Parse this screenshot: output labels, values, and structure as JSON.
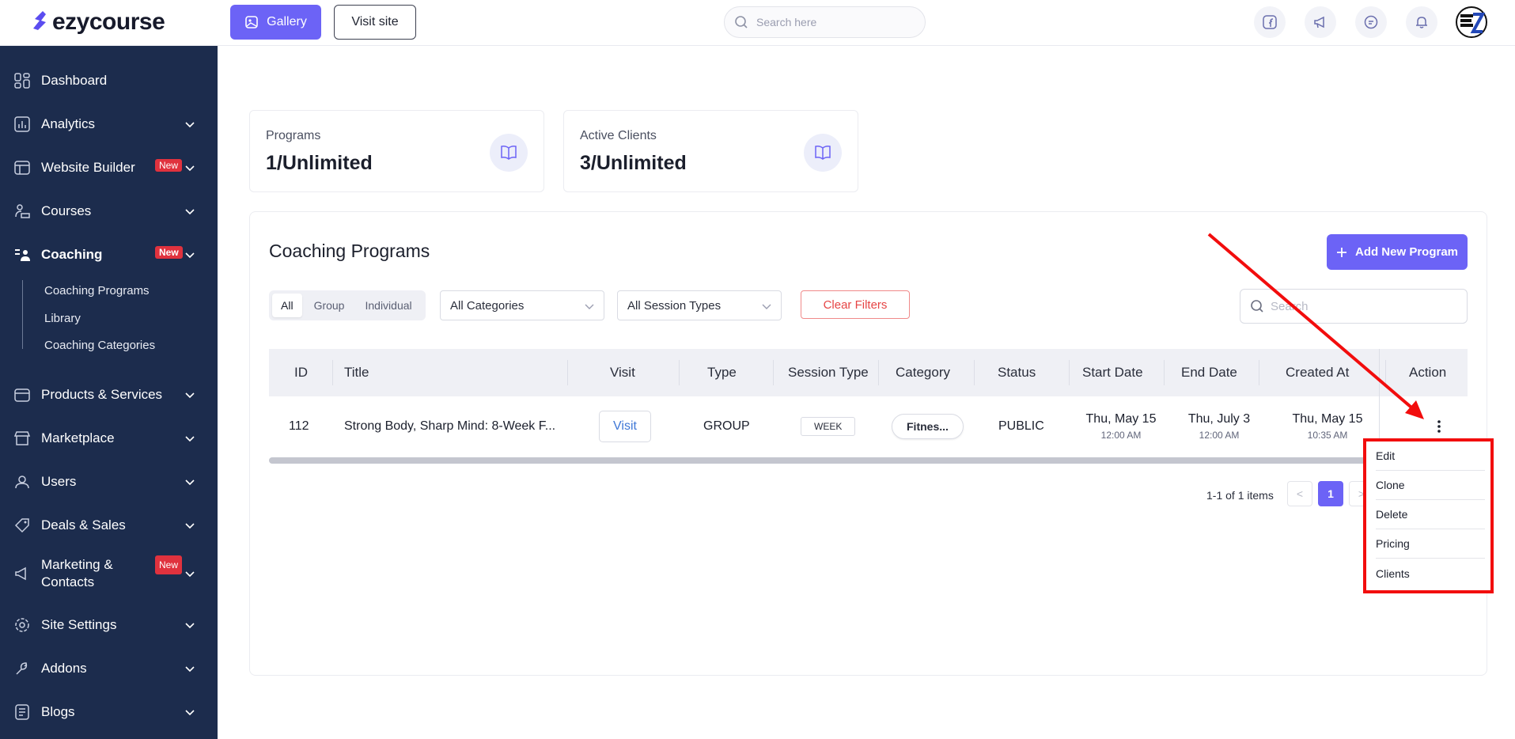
{
  "brand": {
    "name": "ezycourse",
    "accent": "#6c63f6",
    "sidebar_bg": "#1c2c4d"
  },
  "topbar": {
    "gallery_label": "Gallery",
    "visit_site_label": "Visit site",
    "search_placeholder": "Search here",
    "icons": [
      "facebook-icon",
      "megaphone-icon",
      "chat-icon",
      "bell-icon"
    ],
    "avatar_icon": "ez-avatar"
  },
  "sidebar": {
    "items": [
      {
        "label": "Dashboard",
        "icon": "dashboard-icon"
      },
      {
        "label": "Analytics",
        "icon": "analytics-icon"
      },
      {
        "label": "Website Builder",
        "icon": "website-builder-icon",
        "badge": "New"
      },
      {
        "label": "Courses",
        "icon": "courses-icon"
      },
      {
        "label": "Coaching",
        "icon": "coaching-icon",
        "badge": "New",
        "active": true
      },
      {
        "label": "Products & Services",
        "icon": "products-icon"
      },
      {
        "label": "Marketplace",
        "icon": "marketplace-icon"
      },
      {
        "label": "Users",
        "icon": "users-icon"
      },
      {
        "label": "Deals & Sales",
        "icon": "tag-icon"
      },
      {
        "label_line1": "Marketing &",
        "label_line2": "Contacts",
        "icon": "megaphone-icon",
        "badge": "New"
      },
      {
        "label": "Site Settings",
        "icon": "settings-icon"
      },
      {
        "label": "Addons",
        "icon": "addons-icon"
      },
      {
        "label": "Blogs",
        "icon": "blog-icon"
      }
    ],
    "coaching_sub": [
      "Coaching Programs",
      "Library",
      "Coaching Categories"
    ]
  },
  "stats": [
    {
      "label": "Programs",
      "value": "1/Unlimited",
      "icon": "book-icon"
    },
    {
      "label": "Active Clients",
      "value": "3/Unlimited",
      "icon": "book-icon"
    }
  ],
  "panel": {
    "title": "Coaching Programs",
    "add_button": "Add New Program",
    "filters": {
      "segments": [
        "All",
        "Group",
        "Individual"
      ],
      "selected_segment": "All",
      "category_select": "All Categories",
      "session_select": "All Session Types",
      "clear_label": "Clear Filters",
      "search_placeholder": "Search"
    },
    "columns": [
      "ID",
      "Title",
      "Visit",
      "Type",
      "Session Type",
      "Category",
      "Status",
      "Start Date",
      "End Date",
      "Created At",
      "Action"
    ],
    "rows": [
      {
        "id": "112",
        "title": "Strong Body, Sharp Mind: 8-Week F...",
        "visit": "Visit",
        "type": "GROUP",
        "session_type": "WEEK",
        "category": "Fitnes...",
        "status": "PUBLIC",
        "start_date": "Thu, May 15",
        "start_time": "12:00 AM",
        "end_date": "Thu, July 3",
        "end_time": "12:00 AM",
        "created_date": "Thu, May 15",
        "created_time": "10:35 AM"
      }
    ],
    "pagination": {
      "summary": "1-1 of 1 items",
      "current_page": "1",
      "prev": "<",
      "next": ">"
    }
  },
  "action_menu": {
    "items": [
      "Edit",
      "Clone",
      "Delete",
      "Pricing",
      "Clients"
    ],
    "highlight_color": "#f20d0d"
  }
}
